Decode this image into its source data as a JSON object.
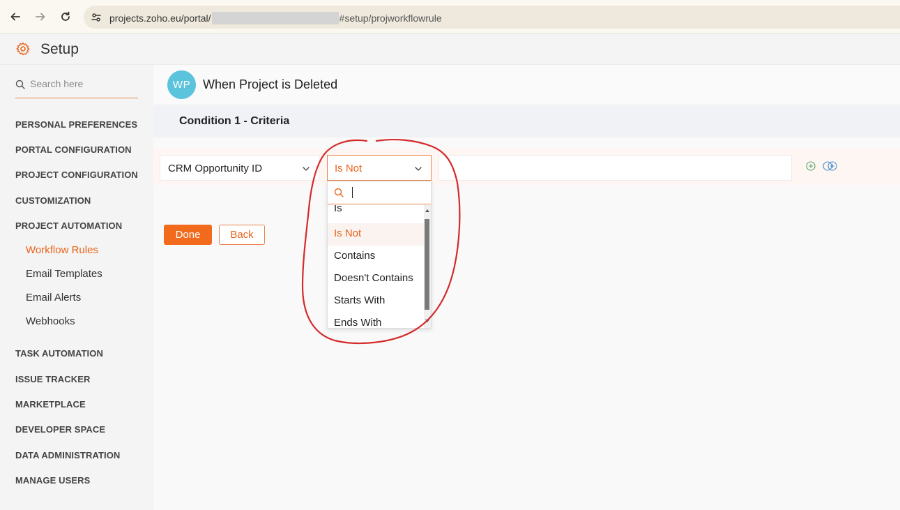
{
  "browser": {
    "url_prefix": "projects.zoho.eu/portal/",
    "url_suffix": "#setup/projworkflowrule",
    "icons": [
      "back-arrow-icon",
      "forward-arrow-icon",
      "reload-icon",
      "site-settings-icon"
    ]
  },
  "header": {
    "title": "Setup",
    "icon": "gear-icon",
    "accent": "#e8641a"
  },
  "sidebar": {
    "search_placeholder": "Search here",
    "sections": [
      {
        "label": "PERSONAL PREFERENCES"
      },
      {
        "label": "PORTAL CONFIGURATION"
      },
      {
        "label": "PROJECT CONFIGURATION"
      },
      {
        "label": "CUSTOMIZATION"
      },
      {
        "label": "PROJECT AUTOMATION"
      },
      {
        "label": "TASK AUTOMATION"
      },
      {
        "label": "ISSUE TRACKER"
      },
      {
        "label": "MARKETPLACE"
      },
      {
        "label": "DEVELOPER SPACE"
      },
      {
        "label": "DATA ADMINISTRATION"
      },
      {
        "label": "MANAGE USERS"
      }
    ],
    "sub_items": [
      {
        "label": "Workflow Rules",
        "active": true
      },
      {
        "label": "Email Templates",
        "active": false
      },
      {
        "label": "Email Alerts",
        "active": false
      },
      {
        "label": "Webhooks",
        "active": false
      }
    ]
  },
  "rule": {
    "avatar_initials": "WP",
    "avatar_color": "#5bc3db",
    "title": "When Project is Deleted",
    "condition_title": "Condition 1 - Criteria"
  },
  "criteria": {
    "field_value": "CRM Opportunity ID",
    "operator_value": "Is Not",
    "value_input": "",
    "icons": [
      "add-circle-icon",
      "add-group-icon"
    ]
  },
  "buttons": {
    "done_label": "Done",
    "back_label": "Back"
  },
  "operator_dropdown": {
    "search_value": "",
    "options": [
      {
        "label": "Is",
        "selected": false
      },
      {
        "label": "Is Not",
        "selected": true
      },
      {
        "label": "Contains",
        "selected": false
      },
      {
        "label": "Doesn't Contains",
        "selected": false
      },
      {
        "label": "Starts With",
        "selected": false
      },
      {
        "label": "Ends With",
        "selected": false
      }
    ]
  },
  "annotation": {
    "shape": "hand-drawn-circle",
    "color": "#d42a2a"
  }
}
